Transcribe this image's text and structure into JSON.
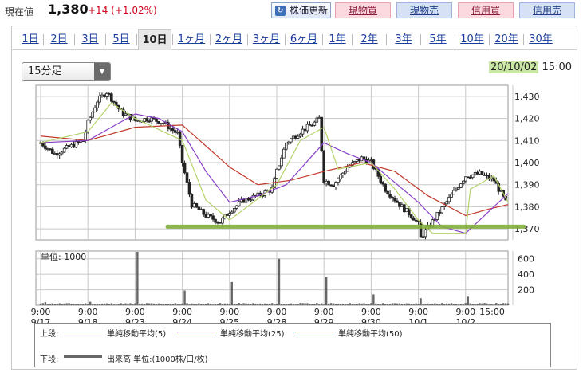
{
  "quote": {
    "label": "現在値",
    "price": "1,380",
    "change": "+14 (+1.02%)"
  },
  "actions": {
    "refresh_label": "株価更新",
    "cash_buy": "現物買",
    "cash_sell": "現物売",
    "margin_buy": "信用買",
    "margin_sell": "信用売"
  },
  "range_tabs": [
    "1日",
    "2日",
    "3日",
    "5日",
    "10日",
    "1ヶ月",
    "2ヶ月",
    "3ヶ月",
    "6ヶ月",
    "1年",
    "2年",
    "3年",
    "5年",
    "10年",
    "20年",
    "30年"
  ],
  "active_tab": "10日",
  "interval_select": {
    "value": "15分足"
  },
  "last_update": {
    "date": "20/10/02",
    "time": "15:00"
  },
  "colors": {
    "ma5": "#b5d36a",
    "ma25": "#8a3fc9",
    "ma50": "#c0392b",
    "support_line": "#7fae3c",
    "volume": "#666666",
    "grid": "#c8c8c8",
    "candle": "#222222"
  },
  "legend": {
    "upper_label": "上段:",
    "ma5": "単純移動平均(5)",
    "ma25": "単純移動平均(25)",
    "ma50": "単純移動平均(50)",
    "lower_label": "下段:",
    "volume": "出来高 単位:(1000株/口/枚)"
  },
  "chart_data": [
    {
      "type": "candlestick",
      "title": "",
      "y_ticks": [
        "1,430",
        "1,420",
        "1,410",
        "1,400",
        "1,390",
        "1,380",
        "1,370"
      ],
      "ylim": [
        1365,
        1435
      ],
      "grid": true,
      "x_time_labels": [
        "9:00",
        "9:00",
        "9:00",
        "9:00",
        "9:00",
        "9:00",
        "9:00",
        "9:00",
        "9:00",
        "9:00",
        "15:00"
      ],
      "x_date_labels": [
        "9/17",
        "9/18",
        "9/23",
        "9/24",
        "9/25",
        "9/28",
        "9/29",
        "9/30",
        "10/1",
        "10/2",
        ""
      ],
      "price_path": [
        [
          0.0,
          1409
        ],
        [
          0.3,
          1404
        ],
        [
          0.6,
          1407
        ],
        [
          0.9,
          1410
        ],
        [
          1.0,
          1418
        ],
        [
          1.2,
          1428
        ],
        [
          1.4,
          1432
        ],
        [
          1.7,
          1423
        ],
        [
          2.0,
          1419
        ],
        [
          2.3,
          1420
        ],
        [
          2.6,
          1418
        ],
        [
          2.9,
          1413
        ],
        [
          3.0,
          1400
        ],
        [
          3.2,
          1381
        ],
        [
          3.5,
          1376
        ],
        [
          3.8,
          1373
        ],
        [
          4.0,
          1378
        ],
        [
          4.3,
          1383
        ],
        [
          4.6,
          1385
        ],
        [
          4.9,
          1388
        ],
        [
          5.0,
          1396
        ],
        [
          5.2,
          1409
        ],
        [
          5.5,
          1414
        ],
        [
          5.8,
          1418
        ],
        [
          5.9,
          1420
        ],
        [
          6.0,
          1392
        ],
        [
          6.2,
          1390
        ],
        [
          6.5,
          1398
        ],
        [
          6.8,
          1402
        ],
        [
          7.0,
          1400
        ],
        [
          7.3,
          1388
        ],
        [
          7.6,
          1381
        ],
        [
          7.9,
          1375
        ],
        [
          8.0,
          1372
        ],
        [
          8.05,
          1366
        ],
        [
          9.0,
          1394
        ],
        [
          9.3,
          1395
        ],
        [
          9.6,
          1392
        ],
        [
          9.8,
          1384
        ],
        [
          9.9,
          1380
        ]
      ],
      "ma5": [
        [
          0.0,
          1409
        ],
        [
          1.0,
          1414
        ],
        [
          1.5,
          1427
        ],
        [
          2.0,
          1420
        ],
        [
          3.0,
          1410
        ],
        [
          3.5,
          1383
        ],
        [
          4.0,
          1374
        ],
        [
          4.5,
          1382
        ],
        [
          5.0,
          1390
        ],
        [
          5.5,
          1410
        ],
        [
          6.0,
          1416
        ],
        [
          6.3,
          1397
        ],
        [
          7.0,
          1400
        ],
        [
          7.5,
          1388
        ],
        [
          8.0,
          1374
        ],
        [
          8.3,
          1368
        ],
        [
          9.0,
          1368
        ],
        [
          9.1,
          1388
        ],
        [
          9.6,
          1394
        ],
        [
          9.9,
          1382
        ]
      ],
      "ma25": [
        [
          0.0,
          1409
        ],
        [
          1.0,
          1410
        ],
        [
          1.5,
          1416
        ],
        [
          2.0,
          1422
        ],
        [
          2.5,
          1420
        ],
        [
          3.0,
          1414
        ],
        [
          3.5,
          1396
        ],
        [
          4.0,
          1382
        ],
        [
          4.6,
          1385
        ],
        [
          5.2,
          1390
        ],
        [
          6.0,
          1409
        ],
        [
          6.5,
          1404
        ],
        [
          7.0,
          1400
        ],
        [
          7.5,
          1391
        ],
        [
          8.0,
          1382
        ],
        [
          8.5,
          1371
        ],
        [
          9.0,
          1368
        ],
        [
          9.5,
          1378
        ],
        [
          9.9,
          1386
        ]
      ],
      "ma50": [
        [
          0.0,
          1412
        ],
        [
          1.0,
          1410
        ],
        [
          2.0,
          1416
        ],
        [
          3.0,
          1417
        ],
        [
          4.0,
          1398
        ],
        [
          4.6,
          1390
        ],
        [
          5.3,
          1392
        ],
        [
          6.0,
          1396
        ],
        [
          6.8,
          1400
        ],
        [
          7.5,
          1396
        ],
        [
          8.2,
          1385
        ],
        [
          9.0,
          1376
        ],
        [
          9.5,
          1379
        ],
        [
          9.9,
          1381
        ]
      ],
      "support_line": 1371
    },
    {
      "type": "bar",
      "title": "",
      "unit_label": "単位: 1000",
      "y_ticks": [
        "600",
        "400",
        "200"
      ],
      "ylim": [
        0,
        700
      ],
      "series_name": "出来高",
      "spikes": [
        [
          0.1,
          40
        ],
        [
          1.05,
          45
        ],
        [
          2.05,
          690
        ],
        [
          3.05,
          190
        ],
        [
          4.05,
          300
        ],
        [
          5.05,
          600
        ],
        [
          6.05,
          360
        ],
        [
          7.05,
          140
        ],
        [
          8.05,
          90
        ],
        [
          9.05,
          110
        ],
        [
          9.95,
          60
        ]
      ]
    }
  ]
}
